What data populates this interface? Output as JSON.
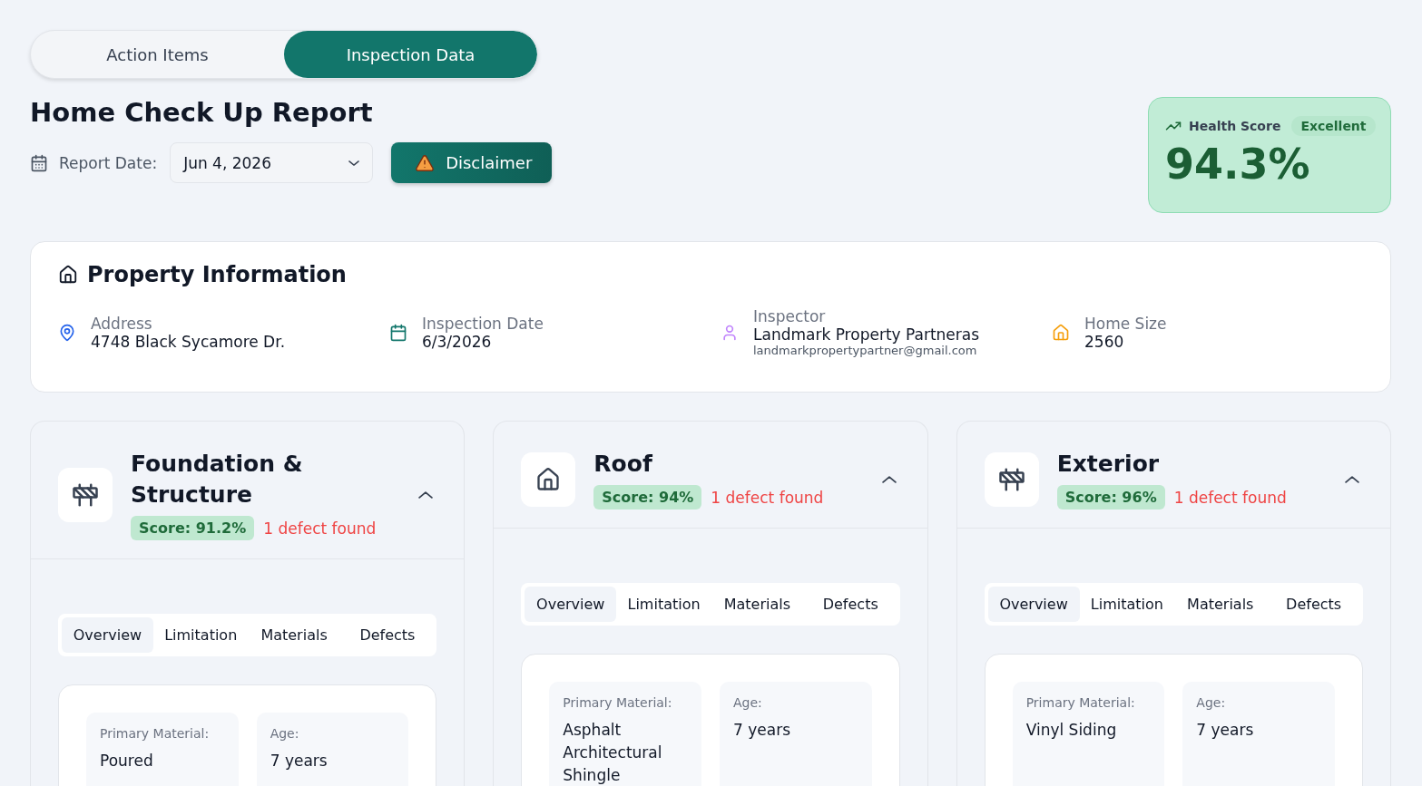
{
  "view_tabs": [
    {
      "label": "Action Items",
      "selected": false
    },
    {
      "label": "Inspection Data",
      "selected": true
    }
  ],
  "title": "Home Check Up Report",
  "report_date": {
    "label": "Report Date:",
    "value": "Jun 4, 2026"
  },
  "disclaimer_button": "Disclaimer",
  "health": {
    "label": "Health Score",
    "badge": "Excellent",
    "value": "94.3%"
  },
  "property": {
    "title": "Property Information",
    "fields": [
      {
        "kind": "address",
        "label": "Address",
        "value": "4748 Black Sycamore Dr."
      },
      {
        "kind": "date",
        "label": "Inspection Date",
        "value": "6/3/2026"
      },
      {
        "kind": "person",
        "label": "Inspector",
        "value": "Landmark Property Partneras",
        "extra": "landmarkpropertypartner@gmail.com"
      },
      {
        "kind": "size",
        "label": "Home Size",
        "value": "2560"
      }
    ]
  },
  "sections": [
    {
      "kind": "structure",
      "title": "Foundation & Structure",
      "score": "Score: 91.2%",
      "defects": "1 defect found",
      "expanded": true,
      "tabs": [
        {
          "label": "Overview",
          "selected": true
        },
        {
          "label": "Limitation",
          "selected": false
        },
        {
          "label": "Materials",
          "selected": false
        },
        {
          "label": "Defects",
          "selected": false
        }
      ],
      "details": [
        {
          "label": "Primary Material:",
          "value": "Poured"
        },
        {
          "label": "Age:",
          "value": "7 years"
        }
      ]
    },
    {
      "kind": "roof",
      "title": "Roof",
      "score": "Score: 94%",
      "defects": "1 defect found",
      "expanded": true,
      "tabs": [
        {
          "label": "Overview",
          "selected": true
        },
        {
          "label": "Limitation",
          "selected": false
        },
        {
          "label": "Materials",
          "selected": false
        },
        {
          "label": "Defects",
          "selected": false
        }
      ],
      "details": [
        {
          "label": "Primary Material:",
          "value": "Asphalt Architectural Shingle"
        },
        {
          "label": "Age:",
          "value": "7 years"
        }
      ]
    },
    {
      "kind": "exterior",
      "title": "Exterior",
      "score": "Score: 96%",
      "defects": "1 defect found",
      "expanded": true,
      "tabs": [
        {
          "label": "Overview",
          "selected": true
        },
        {
          "label": "Limitation",
          "selected": false
        },
        {
          "label": "Materials",
          "selected": false
        },
        {
          "label": "Defects",
          "selected": false
        }
      ],
      "details": [
        {
          "label": "Primary Material:",
          "value": "Vinyl Siding"
        },
        {
          "label": "Age:",
          "value": "7 years"
        }
      ]
    }
  ]
}
